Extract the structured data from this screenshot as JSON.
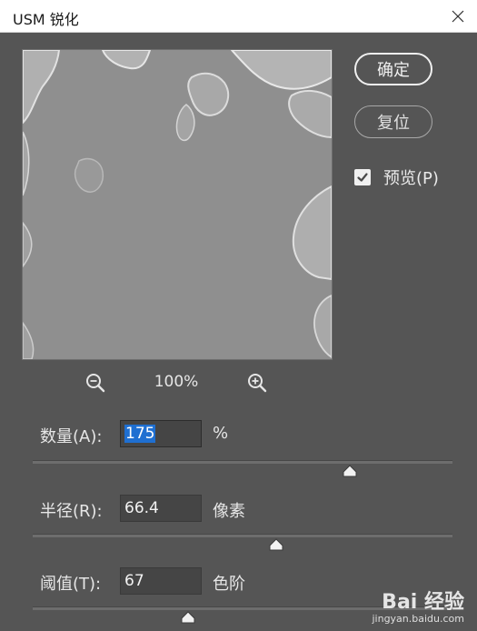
{
  "window": {
    "title": "USM 锐化"
  },
  "buttons": {
    "ok": "确定",
    "reset": "复位"
  },
  "preview_toggle": {
    "label": "预览(P)",
    "checked": true
  },
  "zoom": {
    "level": "100%"
  },
  "params": {
    "amount": {
      "label": "数量(A):",
      "value": "175",
      "unit": "%",
      "slider_fraction": 0.755
    },
    "radius": {
      "label": "半径(R):",
      "value": "66.4",
      "unit": "像素",
      "slider_fraction": 0.58
    },
    "threshold": {
      "label": "阈值(T):",
      "value": "67",
      "unit": "色阶",
      "slider_fraction": 0.37
    }
  },
  "watermark": {
    "brand": "Bai 经验",
    "url": "jingyan.baidu.com"
  },
  "colors": {
    "dialog_bg": "#555555",
    "input_selection": "#1f6fd1"
  }
}
